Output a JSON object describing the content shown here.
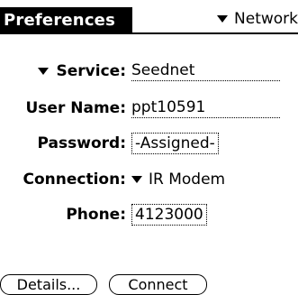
{
  "title": "Preferences",
  "category": "Network",
  "service": {
    "label": "Service:",
    "value": "Seednet"
  },
  "username": {
    "label": "User Name:",
    "value": "ppt10591"
  },
  "password": {
    "label": "Password:",
    "value": "-Assigned-"
  },
  "connection": {
    "label": "Connection:",
    "value": "IR Modem"
  },
  "phone": {
    "label": "Phone:",
    "value": "4123000"
  },
  "buttons": {
    "details": "Details...",
    "connect": "Connect"
  },
  "icons": {
    "dropdown": "triangle-down-icon"
  }
}
